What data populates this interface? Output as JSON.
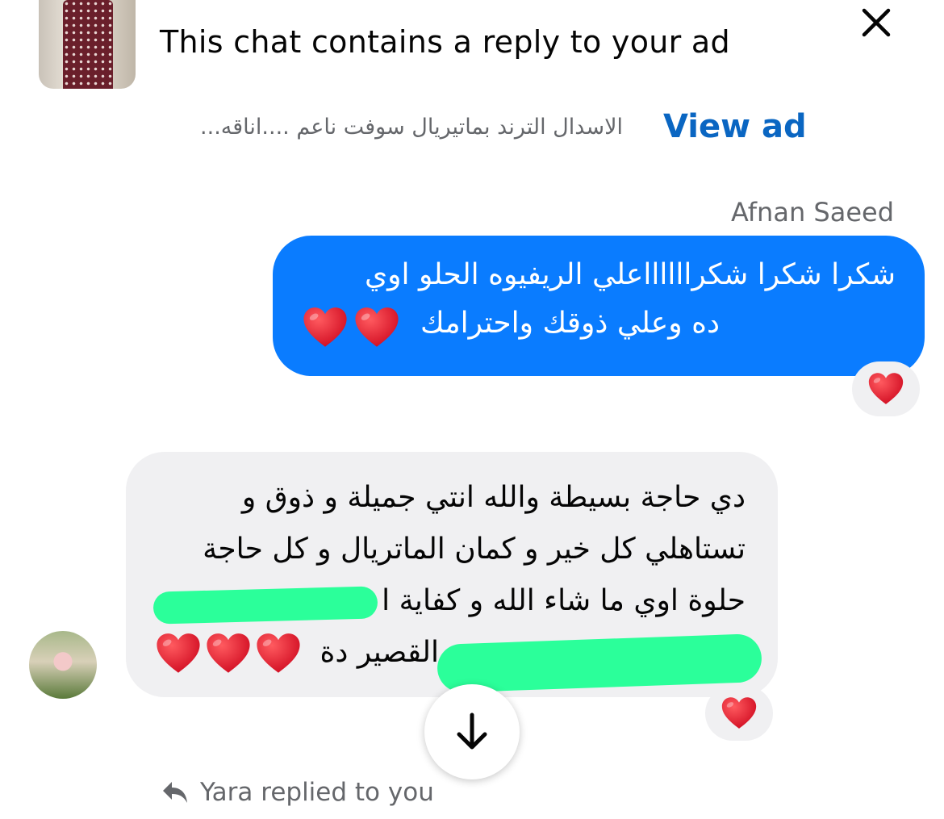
{
  "ad_banner": {
    "title": "This chat contains a reply to your ad",
    "description": "الاسدال الترند بماتيريال سوفت ناعم ....اناقه...",
    "view_ad_label": "View ad",
    "thumbnail_icon": "ad-thumbnail"
  },
  "messages": [
    {
      "direction": "outgoing",
      "sender_name": "Afnan Saeed",
      "lines": [
        "شكرا شكرا شكرااااااعلي الريفيوه الحلو اوي",
        "ده وعلي ذوقك واحترامك"
      ],
      "hearts": 2,
      "reaction": "heart"
    },
    {
      "direction": "incoming",
      "lines": [
        "دي حاجة بسيطة والله انتي جميلة و ذوق و",
        "تستاهلي كل خير و كمان الماتريال و كل حاجة",
        "حلوة اوي ما شاء الله و كفاية ا",
        "القصير دة"
      ],
      "hearts": 3,
      "reaction": "heart"
    }
  ],
  "reply_note": "Yara replied to you",
  "colors": {
    "outgoing_bubble": "#0a7cff",
    "incoming_bubble": "#f0f0f2",
    "link": "#0a66c2",
    "heart": "#e0162b",
    "redaction": "#2bff9a"
  }
}
